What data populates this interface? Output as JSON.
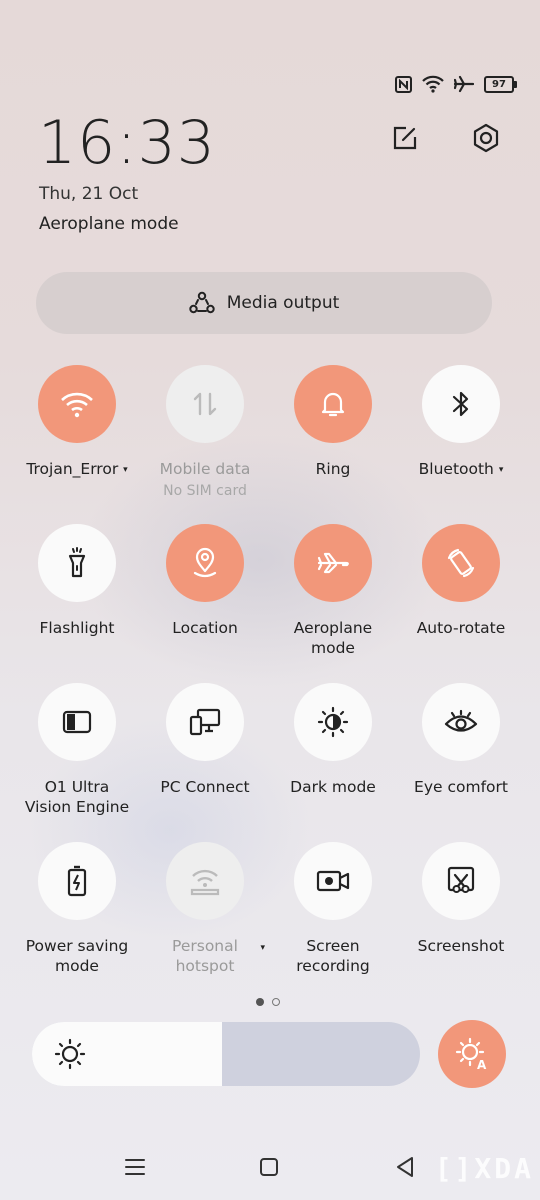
{
  "status_bar": {
    "icons": [
      "nfc-icon",
      "wifi-icon",
      "airplane-icon"
    ],
    "battery_level": "97"
  },
  "header": {
    "time": "16:33",
    "date": "Thu, 21 Oct",
    "mode": "Aeroplane mode",
    "edit_icon": "edit-icon",
    "settings_icon": "gear-icon"
  },
  "media_output": {
    "label": "Media output",
    "icon": "media-output-icon"
  },
  "tiles": [
    {
      "label": "Trojan_Error",
      "state": "on",
      "icon": "wifi-icon",
      "caret": "▾"
    },
    {
      "label": "Mobile data",
      "sub": "No SIM card",
      "state": "disabled",
      "icon": "mobile-data-icon"
    },
    {
      "label": "Ring",
      "state": "on",
      "icon": "bell-icon"
    },
    {
      "label": "Bluetooth",
      "state": "off",
      "icon": "bluetooth-icon",
      "caret": "▾"
    },
    {
      "label": "Flashlight",
      "state": "off",
      "icon": "flashlight-icon"
    },
    {
      "label": "Location",
      "state": "on",
      "icon": "location-icon"
    },
    {
      "label": "Aeroplane\nmode",
      "state": "on",
      "icon": "airplane-icon"
    },
    {
      "label": "Auto-rotate",
      "state": "on",
      "icon": "auto-rotate-icon"
    },
    {
      "label": "O1 Ultra\nVision Engine",
      "state": "off",
      "icon": "vision-engine-icon"
    },
    {
      "label": "PC Connect",
      "state": "off",
      "icon": "pc-connect-icon"
    },
    {
      "label": "Dark mode",
      "state": "off",
      "icon": "dark-mode-icon"
    },
    {
      "label": "Eye comfort",
      "state": "off",
      "icon": "eye-icon"
    },
    {
      "label": "Power saving\nmode",
      "state": "off",
      "icon": "battery-saver-icon"
    },
    {
      "label": "Personal\nhotspot",
      "state": "disabled",
      "icon": "hotspot-icon",
      "caret": "▾"
    },
    {
      "label": "Screen\nrecording",
      "state": "off",
      "icon": "screen-record-icon"
    },
    {
      "label": "Screenshot",
      "state": "off",
      "icon": "screenshot-icon"
    }
  ],
  "pager": {
    "pages": 2,
    "current": 1
  },
  "brightness": {
    "level": 0.49,
    "auto_brightness": true
  },
  "colors": {
    "accent": "#f2977a",
    "tile_off": "#fafafa",
    "tile_disabled": "#eeeeee"
  },
  "watermark": "[]XDA"
}
